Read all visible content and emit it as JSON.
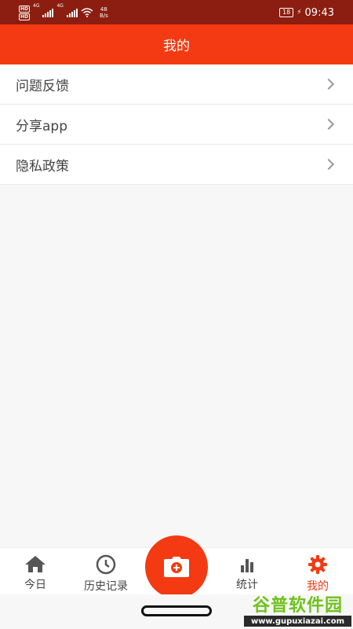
{
  "status_bar": {
    "hd_1": "HD",
    "hd_2": "HD",
    "net_1": "4G",
    "net_2": "4G",
    "speed_value": "48",
    "speed_unit": "B/s",
    "battery": "18",
    "time": "09:43"
  },
  "header": {
    "title": "我的"
  },
  "menu": {
    "items": [
      {
        "label": "问题反馈"
      },
      {
        "label": "分享app"
      },
      {
        "label": "隐私政策"
      }
    ]
  },
  "tab_bar": {
    "tabs": [
      {
        "label": "今日",
        "icon": "home-icon"
      },
      {
        "label": "历史记录",
        "icon": "clock-icon"
      },
      {
        "label": "统计",
        "icon": "bar-chart-icon"
      },
      {
        "label": "我的",
        "icon": "gear-icon",
        "active": true
      }
    ],
    "center_action_icon": "camera-plus-icon"
  },
  "watermark": {
    "title": "谷普软件园",
    "url": "www.gupuxiazai.com"
  },
  "colors": {
    "status_bar": "#8b1e10",
    "accent": "#f33a12",
    "background": "#f7f7f7"
  }
}
